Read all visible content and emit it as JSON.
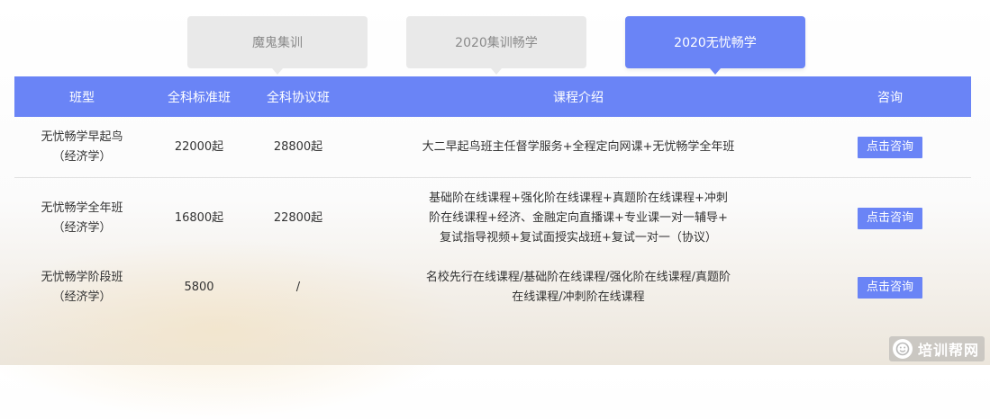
{
  "tabs": [
    {
      "label": "魔鬼集训",
      "active": false
    },
    {
      "label": "2020集训畅学",
      "active": false
    },
    {
      "label": "2020无忧畅学",
      "active": true
    }
  ],
  "table": {
    "headers": [
      "班型",
      "全科标准班",
      "全科协议班",
      "课程介绍",
      "咨询"
    ],
    "rows": [
      {
        "name": "无忧畅学早起鸟",
        "subject": "（经济学）",
        "standard": "22000起",
        "agreement": "28800起",
        "desc_lines": [
          "大二早起鸟班主任督学服务+全程定向网课+无忧畅学全年班"
        ],
        "button": "点击咨询"
      },
      {
        "name": "无忧畅学全年班",
        "subject": "（经济学）",
        "standard": "16800起",
        "agreement": "22800起",
        "desc_lines": [
          "基础阶在线课程+强化阶在线课程+真题阶在线课程+冲刺",
          "阶在线课程+经济、金融定向直播课+专业课一对一辅导+",
          "复试指导视频+复试面授实战班+复试一对一（协议）"
        ],
        "button": "点击咨询"
      },
      {
        "name": "无忧畅学阶段班",
        "subject": "（经济学）",
        "standard": "5800",
        "agreement": "/",
        "desc_lines": [
          "名校先行在线课程/基础阶在线课程/强化阶在线课程/真题阶",
          "在线课程/冲刺阶在线课程"
        ],
        "button": "点击咨询"
      }
    ]
  },
  "watermark": {
    "text": "培训帮网",
    "icon": "smile-logo-icon"
  },
  "colors": {
    "accent": "#6a84f6",
    "tab_inactive": "#e9e9e9"
  }
}
